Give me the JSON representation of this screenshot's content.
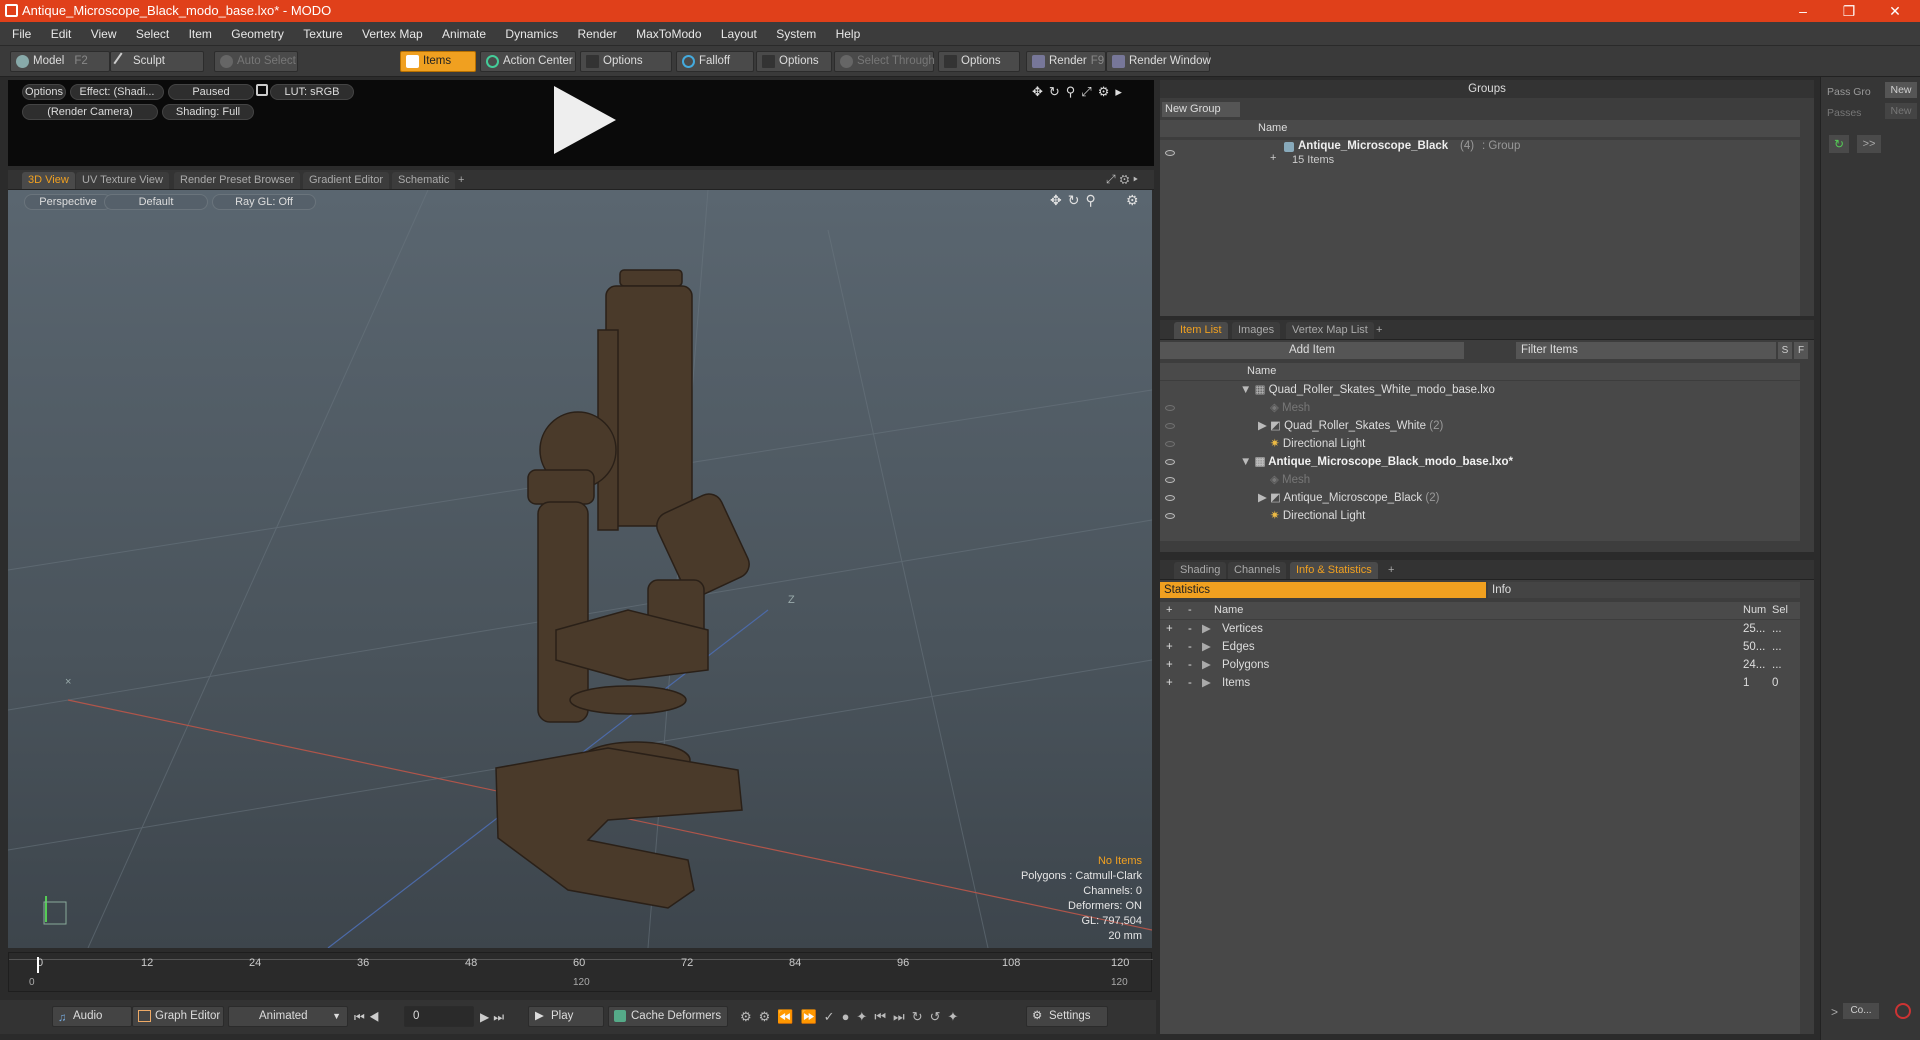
{
  "window": {
    "title": "Antique_Microscope_Black_modo_base.lxo* - MODO",
    "minimize": "–",
    "maximize": "❐",
    "close": "✕"
  },
  "menu": [
    "File",
    "Edit",
    "View",
    "Select",
    "Item",
    "Geometry",
    "Texture",
    "Vertex Map",
    "Animate",
    "Dynamics",
    "Render",
    "MaxToModo",
    "Layout",
    "System",
    "Help"
  ],
  "toolbar": {
    "model": "Model",
    "model_key": "F2",
    "sculpt": "Sculpt",
    "auto_select": "Auto Select",
    "items": "Items",
    "action_center": "Action Center",
    "options1": "Options",
    "falloff": "Falloff",
    "options2": "Options",
    "select_through": "Select Through",
    "options3": "Options",
    "render": "Render",
    "render_key": "F9",
    "render_window": "Render Window"
  },
  "preview": {
    "options": "Options",
    "effect": "Effect: (Shadi...",
    "paused": "Paused",
    "lut": "LUT: sRGB",
    "camera": "(Render Camera)",
    "shading": "Shading: Full"
  },
  "viewport_tabs": [
    "3D View",
    "UV Texture View",
    "Render Preset Browser",
    "Gradient Editor",
    "Schematic",
    "+"
  ],
  "viewport": {
    "perspective": "Perspective",
    "default": "Default",
    "raygl": "Ray GL: Off",
    "axis_z": "Z",
    "info": {
      "no_items": "No Items",
      "polygons": "Polygons : Catmull-Clark",
      "channels": "Channels: 0",
      "deformers": "Deformers: ON",
      "gl": "GL: 797,504",
      "mm": "20 mm"
    }
  },
  "timeline": {
    "ticks": [
      "0",
      "12",
      "24",
      "36",
      "48",
      "60",
      "72",
      "84",
      "96",
      "108",
      "120"
    ],
    "range_start": "0",
    "range_mid": "120",
    "range_end": "120"
  },
  "bottom": {
    "audio": "Audio",
    "graph_editor": "Graph Editor",
    "animated": "Animated",
    "frame": "0",
    "play": "Play",
    "cache": "Cache Deformers",
    "settings": "Settings"
  },
  "groups": {
    "title": "Groups",
    "new_group": "New Group",
    "col_name": "Name",
    "row_name": "Antique_Microscope_Black",
    "row_count": "(4)",
    "row_type": ": Group",
    "row_items": "15 Items"
  },
  "far_right": {
    "pass_group": "Pass Gro",
    "new1": "New",
    "passes": "Passes",
    "new2": "New",
    "co": "Co..."
  },
  "itemlist": {
    "tabs": [
      "Item List",
      "Images",
      "Vertex Map List",
      "+"
    ],
    "add_item": "Add Item",
    "filter": "Filter Items",
    "s": "S",
    "f": "F",
    "col_name": "Name",
    "rows": [
      {
        "label": "Quad_Roller_Skates_White_modo_base.lxo",
        "bold": false
      },
      {
        "label": "Mesh",
        "bold": false
      },
      {
        "label": "Quad_Roller_Skates_White",
        "count": "(2)",
        "bold": false
      },
      {
        "label": "Directional Light",
        "bold": false
      },
      {
        "label": "Antique_Microscope_Black_modo_base.lxo*",
        "bold": true
      },
      {
        "label": "Mesh",
        "bold": false
      },
      {
        "label": "Antique_Microscope_Black",
        "count": "(2)",
        "bold": false
      },
      {
        "label": "Directional Light",
        "bold": false
      }
    ]
  },
  "stats": {
    "tabs": [
      "Shading",
      "Channels",
      "Info & Statistics",
      "+"
    ],
    "statistics": "Statistics",
    "info": "Info",
    "col_name": "Name",
    "col_num": "Num",
    "col_sel": "Sel",
    "rows": [
      {
        "name": "Vertices",
        "num": "25...",
        "sel": "..."
      },
      {
        "name": "Edges",
        "num": "50...",
        "sel": "..."
      },
      {
        "name": "Polygons",
        "num": "24...",
        "sel": "..."
      },
      {
        "name": "Items",
        "num": "1",
        "sel": "0"
      }
    ]
  }
}
